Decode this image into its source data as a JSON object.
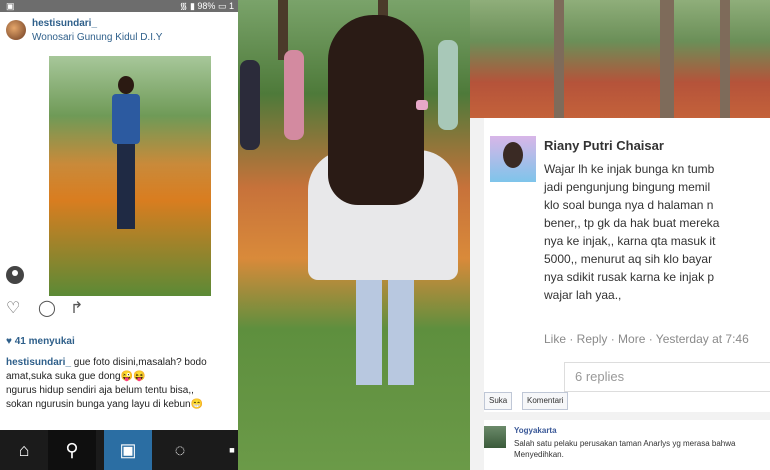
{
  "left": {
    "status": {
      "percent": "98%",
      "time": "1"
    },
    "username": "hestisundari_",
    "location": "Wonosari Gunung Kidul D.I.Y",
    "likes": "♥ 41 menyukai",
    "caption_user": "hestisundari_",
    "caption_lines": [
      " gue foto disini,masalah? bodo",
      "amat,suka suka gue dong😜😝",
      "ngurus hidup sendiri aja belum tentu bisa,,",
      "sokan ngurusin bunga yang layu di kebun😁"
    ],
    "icons": {
      "like": "heart-icon",
      "comment": "comment-icon",
      "share": "share-icon"
    },
    "nav": [
      "home-icon",
      "search-icon",
      "camera-icon",
      "activity-icon",
      "profile-icon"
    ]
  },
  "right": {
    "name": "Riany Putri Chaisar",
    "comment": "Wajar lh ke injak bunga kn tumb\njadi pengunjung bingung memil\nklo soal bunga nya d halaman n\nbener,, tp gk da hak buat mereka\nnya ke injak,, karna qta masuk it\n5000,, menurut aq sih klo bayar\nnya sdikit rusak karna ke injak p\nwajar lah yaa.,",
    "meta": "Like · Reply · More · Yesterday at 7:46",
    "replies": "6 replies",
    "fb_buttons": [
      "Suka",
      "Komentari"
    ],
    "fb_name": "Yogyakarta",
    "fb_text": "Salah satu pelaku perusakan taman Anarlys yg merasa bahwa\nMenyedihkan."
  }
}
